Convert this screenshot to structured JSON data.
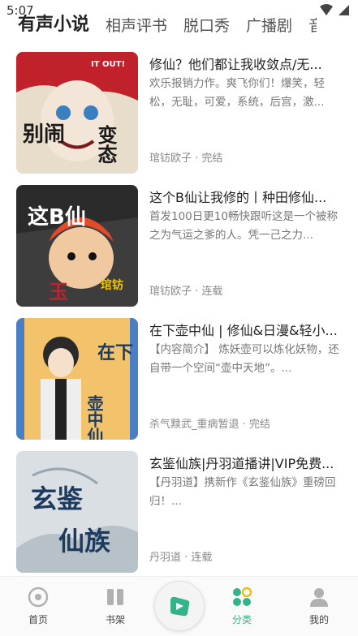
{
  "status_bar": {
    "time": "5:07"
  },
  "tabs": [
    "有声小说",
    "相声评书",
    "脱口秀",
    "广播剧",
    "音"
  ],
  "items": [
    {
      "title": "修仙？他们都让我收敛点/无...",
      "desc": "欢乐报销力作。爽飞你们！爆笑，轻松，无耻，可爱，系统，后宫，激...",
      "meta": "琯钫欧子 · 完结",
      "cover_text": [
        "别闹",
        "变态",
        "IT OUT!"
      ],
      "cover_colors": [
        "#e8dccb",
        "#c0212b"
      ]
    },
    {
      "title": "这个B仙让我修的丨种田修仙...",
      "desc": "首发100日更10畅快跟听这是一个被称之为气运之爹的人。凭一己之力...",
      "meta": "琯钫欧子 · 连载",
      "cover_text": [
        "这B仙",
        "玉",
        "琯钫"
      ],
      "cover_colors": [
        "#2b2b2b",
        "#e24a2a"
      ]
    },
    {
      "title": "在下壶中仙 | 修仙&日漫&轻小...",
      "desc": "【内容简介】 炼妖壶可以炼化妖物，还自带一个空间“壶中天地”。...",
      "meta": "杀气黩武_重病暂退 · 完结",
      "cover_text": [
        "在下",
        "壶中仙"
      ],
      "cover_colors": [
        "#f2c36b",
        "#4a7fc4"
      ]
    },
    {
      "title": "玄鉴仙族|丹羽道播讲|VIP免费...",
      "desc": "【丹羽道】携新作《玄鉴仙族》重磅回归！...",
      "meta": "丹羽道 · 连载",
      "cover_text": [
        "玄鉴",
        "仙族"
      ],
      "cover_colors": [
        "#d9dfe3",
        "#1f3a5f"
      ]
    }
  ],
  "nav": {
    "home": "首页",
    "shelf": "书架",
    "category": "分类",
    "mine": "我的"
  },
  "colors": {
    "accent": "#34b38a"
  }
}
